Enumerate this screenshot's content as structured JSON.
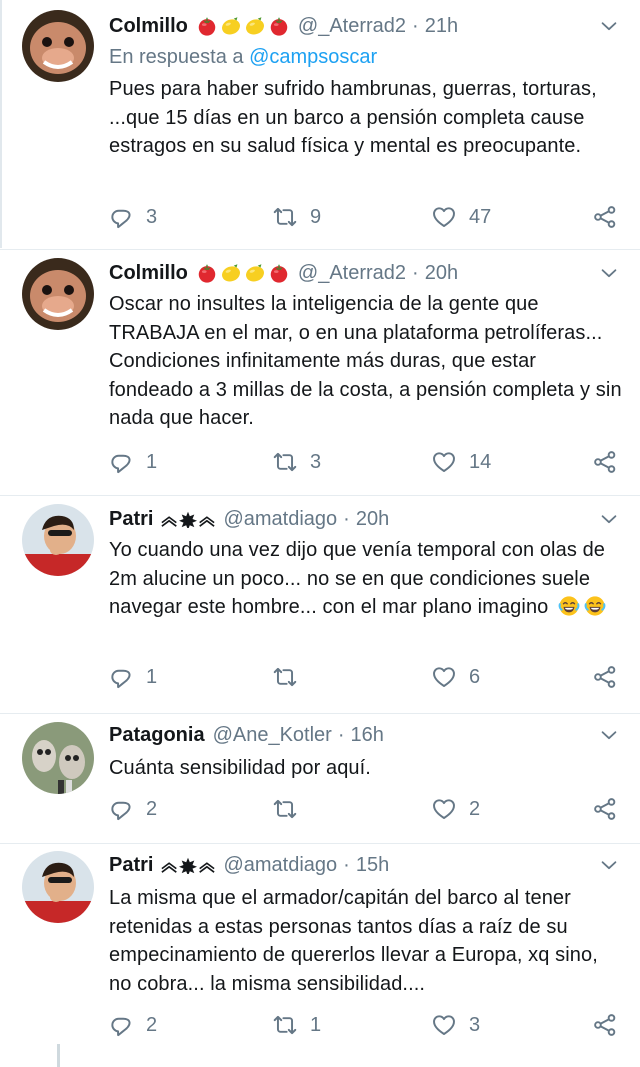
{
  "tweets": [
    {
      "name": "Colmillo",
      "emojis": [
        "tomato",
        "lemon",
        "lemon",
        "tomato"
      ],
      "handle": "@_Aterrad2",
      "time": "21h",
      "reply_prefix": "En respuesta a",
      "reply_mention": "@campsoscar",
      "text": "Pues para haber sufrido hambrunas, guerras, torturas, ...que 15 días en un barco a pensión completa cause estragos en su salud física y mental es preocupante.",
      "replies": "3",
      "retweets": "9",
      "likes": "47"
    },
    {
      "name": "Colmillo",
      "emojis": [
        "tomato",
        "lemon",
        "lemon",
        "tomato"
      ],
      "handle": "@_Aterrad2",
      "time": "20h",
      "text": "Oscar no insultes la inteligencia de la gente que TRABAJA en el mar, o en una plataforma petrolíferas...  Condiciones infinitamente más duras, que estar fondeado a 3 millas de la costa, a pensión completa y sin nada que hacer.",
      "replies": "1",
      "retweets": "3",
      "likes": "14"
    },
    {
      "name": "Patri",
      "handle": "@amatdiago",
      "time": "20h",
      "text": "Yo cuando una vez dijo que venía temporal con olas de 2m alucine un poco... no se en que condiciones suele navegar este hombre... con el mar plano imagino",
      "replies": "1",
      "retweets": "",
      "likes": "6"
    },
    {
      "name": "Patagonia",
      "handle": "@Ane_Kotler",
      "time": "16h",
      "text": "Cuánta sensibilidad por aquí.",
      "replies": "2",
      "retweets": "",
      "likes": "2"
    },
    {
      "name": "Patri",
      "handle": "@amatdiago",
      "time": "15h",
      "text": "La misma que el armador/capitán del barco al tener retenidas a estas personas tantos días a raíz de su empecinamiento de quererlos llevar a Europa, xq sino, no cobra... la misma sensibilidad....",
      "replies": "2",
      "retweets": "1",
      "likes": "3"
    }
  ],
  "dot": "·",
  "icons": {
    "reply": "reply-icon",
    "retweet": "retweet-icon",
    "like": "heart-icon",
    "share": "share-icon",
    "caret": "chevron-down-icon",
    "military_badge": "rank-insignia-icon",
    "laugh": "tears-of-joy-emoji"
  },
  "colors": {
    "secondary_text": "#657786",
    "link": "#1da1f2",
    "divider": "#e6ecf0"
  }
}
